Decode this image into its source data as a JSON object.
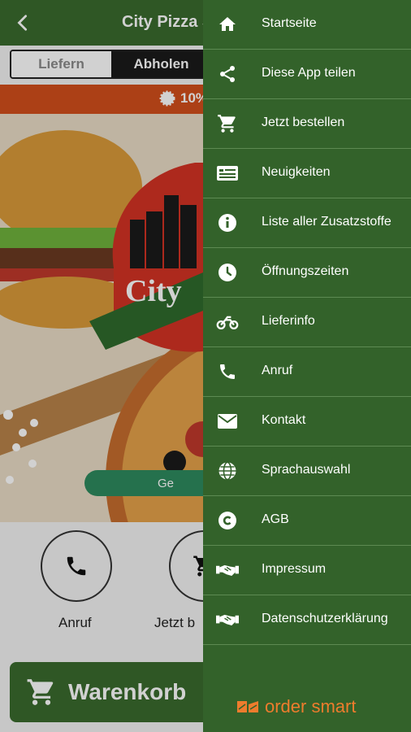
{
  "app_bar": {
    "title": "City Pizza S",
    "back_icon": "chevron-left-icon"
  },
  "order_mode": {
    "options": [
      "Liefern",
      "Abholen"
    ],
    "selected": "Abholen"
  },
  "promo": {
    "text": "10%"
  },
  "hero": {
    "logo_text": "City",
    "info_pill_text": "Ge"
  },
  "quick_actions": [
    {
      "label": "Anruf",
      "icon": "phone-icon"
    },
    {
      "label": "Jetzt b",
      "icon": "cart-icon"
    }
  ],
  "cart_button": {
    "label": "Warenkorb",
    "icon": "cart-icon"
  },
  "drawer": {
    "items": [
      {
        "label": "Startseite",
        "icon": "home-icon"
      },
      {
        "label": "Diese App teilen",
        "icon": "share-icon"
      },
      {
        "label": "Jetzt bestellen",
        "icon": "cart-icon"
      },
      {
        "label": "Neuigkeiten",
        "icon": "news-icon"
      },
      {
        "label": "Liste aller Zusatzstoffe",
        "icon": "info-icon"
      },
      {
        "label": "Öffnungszeiten",
        "icon": "clock-icon"
      },
      {
        "label": "Lieferinfo",
        "icon": "motorbike-icon"
      },
      {
        "label": "Anruf",
        "icon": "phone-icon"
      },
      {
        "label": "Kontakt",
        "icon": "mail-icon"
      },
      {
        "label": "Sprachauswahl",
        "icon": "globe-icon"
      },
      {
        "label": "AGB",
        "icon": "copyright-icon"
      },
      {
        "label": "Impressum",
        "icon": "handshake-icon"
      },
      {
        "label": "Datenschutzerklärung",
        "icon": "handshake-icon"
      }
    ],
    "brand": "order smart"
  },
  "colors": {
    "primary_green": "#3a6b2e",
    "drawer_green": "#33622a",
    "promo_orange": "#d24f1c",
    "brand_orange": "#ee7c2d",
    "pill_green": "#2e8a5e"
  }
}
